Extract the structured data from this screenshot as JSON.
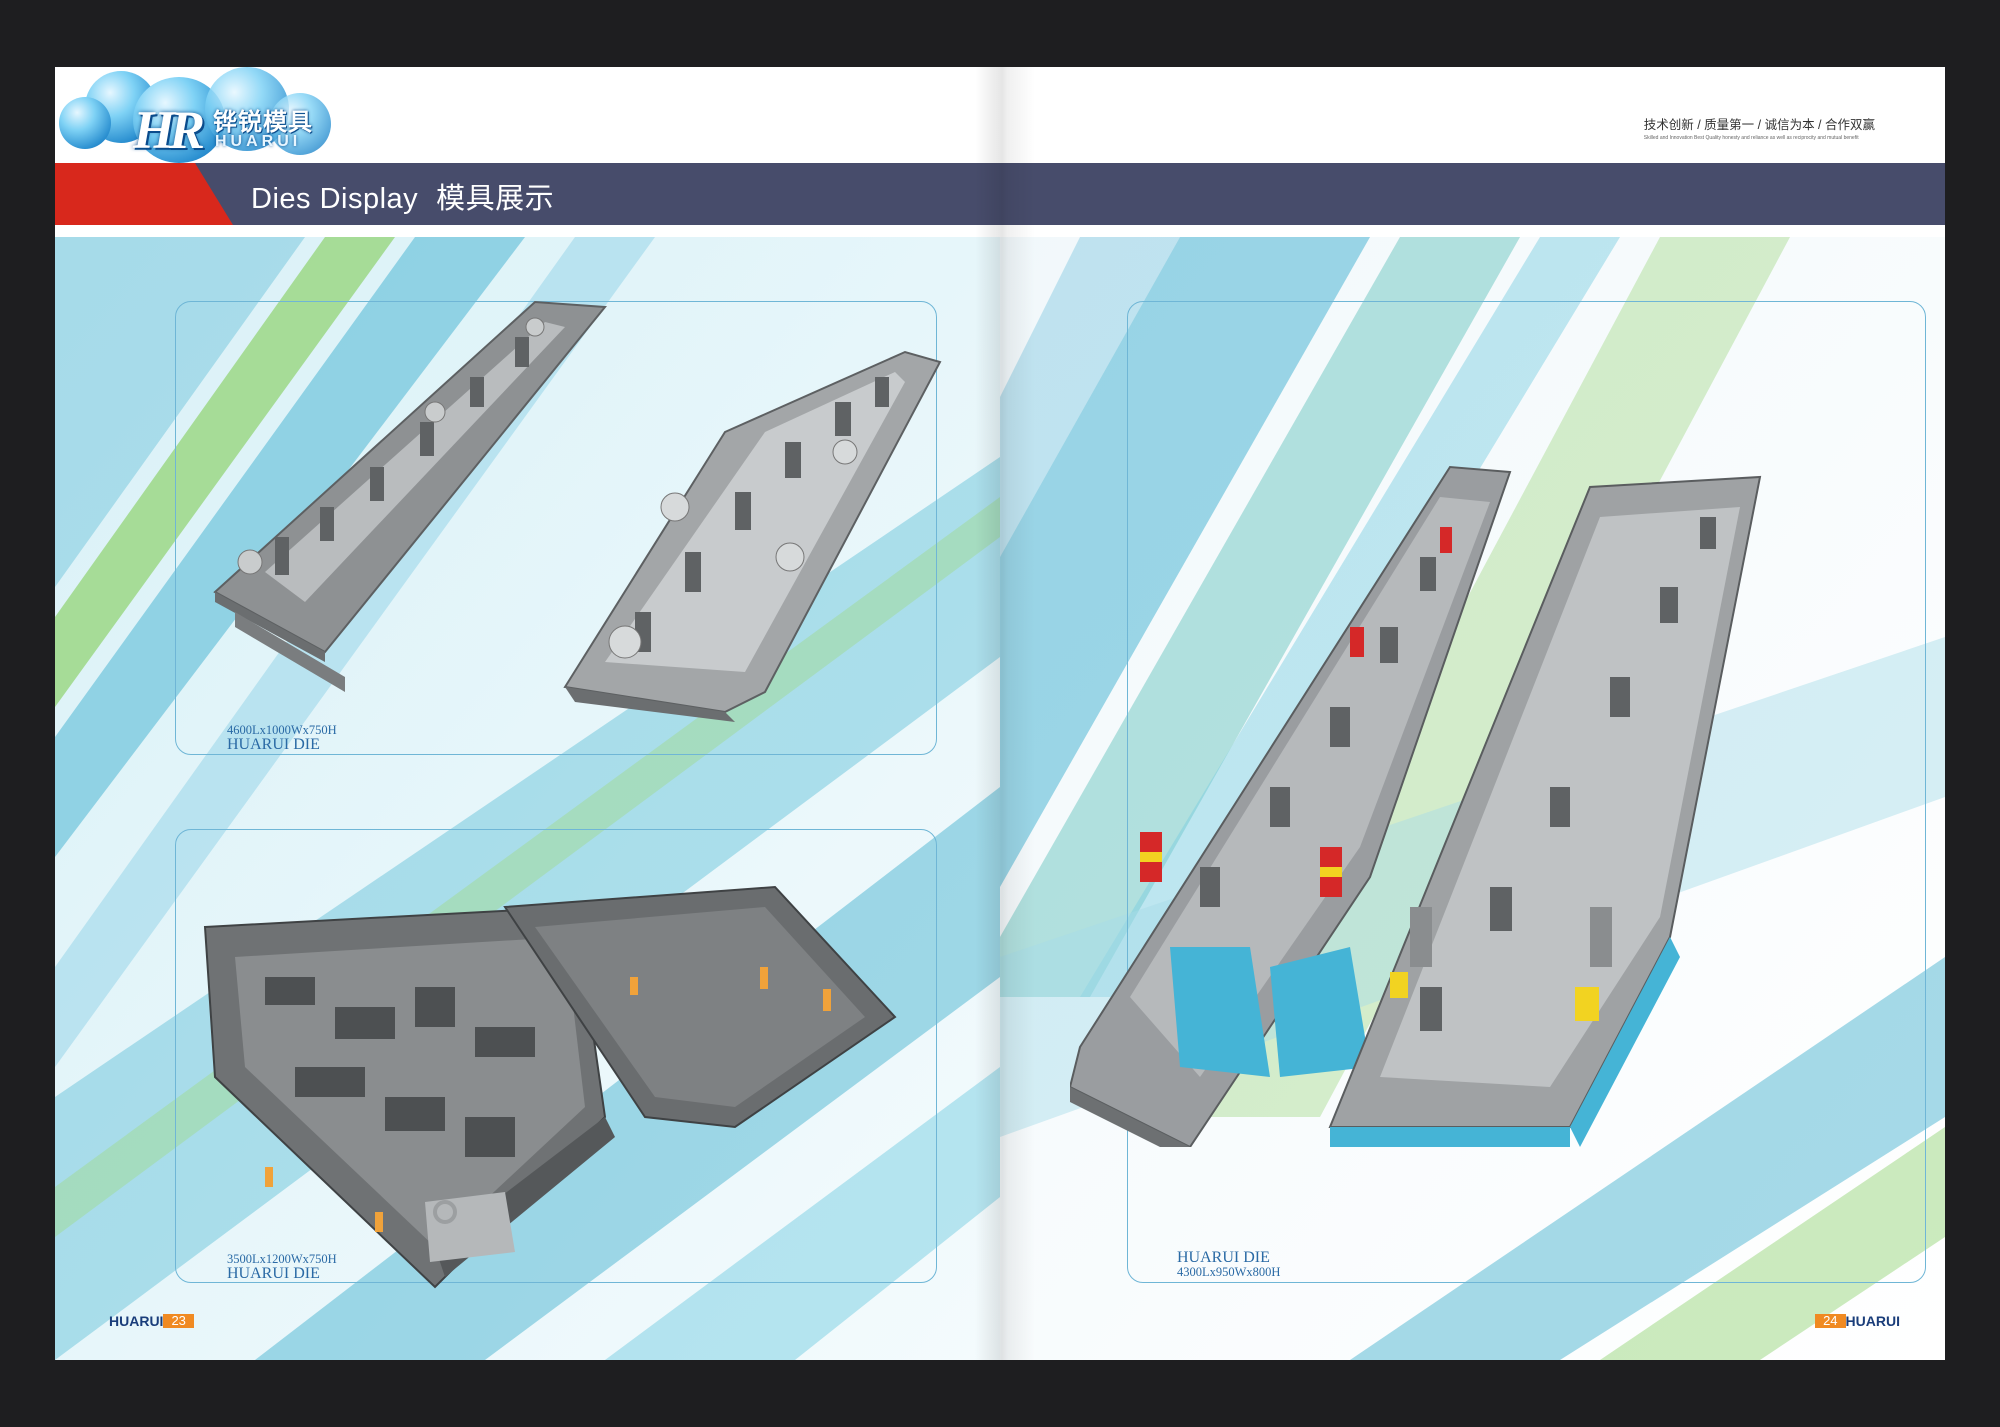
{
  "header": {
    "title_en": "Dies Display",
    "title_cn": "模具展示"
  },
  "logo": {
    "letters": "HR",
    "name_cn": "铧锐模具",
    "name_en": "HUARUI"
  },
  "slogan": {
    "cn": "技术创新 / 质量第一 / 诚信为本 / 合作双赢",
    "en": "Skilled and Innovation Best Quality honesty and reliance as well as reciprocity and mutual benefit"
  },
  "left_page": {
    "panels": [
      {
        "dims": "4600Lx1000Wx750H",
        "name": "HUARUI DIE"
      },
      {
        "dims": "3500Lx1200Wx750H",
        "name": "HUARUI DIE"
      }
    ],
    "footer": {
      "brand": "HUARUI",
      "page_number": "23"
    }
  },
  "right_page": {
    "panel": {
      "name": "HUARUI DIE",
      "dims": "4300Lx950Wx800H"
    },
    "footer": {
      "brand": "HUARUI",
      "page_number": "24"
    }
  },
  "colors": {
    "header_bar": "#474c6b",
    "header_accent": "#d8281c",
    "caption_text": "#2a6aa5",
    "page_number_badge": "#f08a22",
    "stripe_blue": "#5ab7d6",
    "stripe_green": "#8fd26e"
  }
}
